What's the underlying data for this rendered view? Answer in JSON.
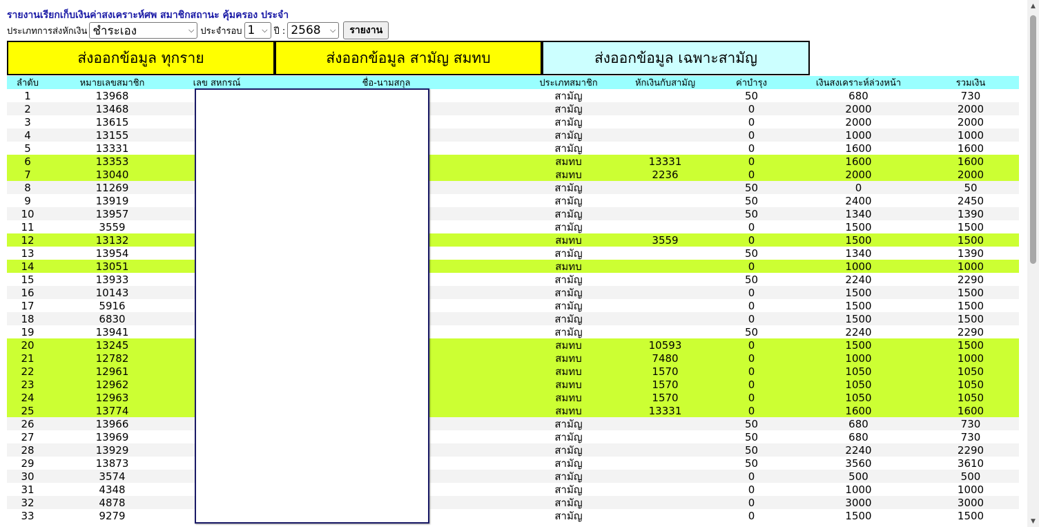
{
  "title": "รายงานเรียกเก็บเงินค่าสงเคราะห์ศพ สมาชิกสถานะ คุ้มครอง ประจำ",
  "filters": {
    "deduct_type_label": "ประเภทการส่งหักเงิน",
    "deduct_type_value": "ชำระเอง",
    "round_label": "ประจำรอบ",
    "round_value": "1",
    "year_label": "ปี :",
    "year_value": "2568",
    "report_button": "รายงาน"
  },
  "export_buttons": [
    {
      "label": "ส่งออกข้อมูล ทุกราย",
      "color": "#ffff00"
    },
    {
      "label": "ส่งออกข้อมูล สามัญ สมทบ",
      "color": "#ffff00"
    },
    {
      "label": "ส่งออกข้อมูล เฉพาะสามัญ",
      "color": "#ccffff"
    }
  ],
  "colors": {
    "header_bg": "#99ffff",
    "highlight_row": "#ccff33",
    "alt_row": "#f3f3f3",
    "title": "#1a1aa6"
  },
  "table": {
    "headers": [
      "ลำดับ",
      "หมายเลขสมาชิก",
      "เลข สหกรณ์",
      "ชื่อ-นามสกุล",
      "ประเภทสมาชิก",
      "หักเงินกับสามัญ",
      "ค่าบำรุง",
      "เงินสงเคราะห์ล่วงหน้า",
      "รวมเงิน"
    ],
    "rows": [
      [
        "1",
        "13968",
        "",
        "",
        "สามัญ",
        "",
        "50",
        "680",
        "730"
      ],
      [
        "2",
        "13468",
        "",
        "",
        "สามัญ",
        "",
        "0",
        "2000",
        "2000"
      ],
      [
        "3",
        "13615",
        "",
        "",
        "สามัญ",
        "",
        "0",
        "2000",
        "2000"
      ],
      [
        "4",
        "13155",
        "",
        "",
        "สามัญ",
        "",
        "0",
        "1000",
        "1000"
      ],
      [
        "5",
        "13331",
        "",
        "",
        "สามัญ",
        "",
        "0",
        "1600",
        "1600"
      ],
      [
        "6",
        "13353",
        "",
        "",
        "สมทบ",
        "13331",
        "0",
        "1600",
        "1600"
      ],
      [
        "7",
        "13040",
        "",
        "",
        "สมทบ",
        "2236",
        "0",
        "2000",
        "2000"
      ],
      [
        "8",
        "11269",
        "",
        "",
        "สามัญ",
        "",
        "50",
        "0",
        "50"
      ],
      [
        "9",
        "13919",
        "",
        "",
        "สามัญ",
        "",
        "50",
        "2400",
        "2450"
      ],
      [
        "10",
        "13957",
        "",
        "",
        "สามัญ",
        "",
        "50",
        "1340",
        "1390"
      ],
      [
        "11",
        "3559",
        "",
        "",
        "สามัญ",
        "",
        "0",
        "1500",
        "1500"
      ],
      [
        "12",
        "13132",
        "",
        "",
        "สมทบ",
        "3559",
        "0",
        "1500",
        "1500"
      ],
      [
        "13",
        "13954",
        "",
        "",
        "สามัญ",
        "",
        "50",
        "1340",
        "1390"
      ],
      [
        "14",
        "13051",
        "",
        "",
        "สมทบ",
        "",
        "0",
        "1000",
        "1000"
      ],
      [
        "15",
        "13933",
        "",
        "",
        "สามัญ",
        "",
        "50",
        "2240",
        "2290"
      ],
      [
        "16",
        "10143",
        "",
        "",
        "สามัญ",
        "",
        "0",
        "1500",
        "1500"
      ],
      [
        "17",
        "5916",
        "",
        "",
        "สามัญ",
        "",
        "0",
        "1500",
        "1500"
      ],
      [
        "18",
        "6830",
        "",
        "",
        "สามัญ",
        "",
        "0",
        "1500",
        "1500"
      ],
      [
        "19",
        "13941",
        "",
        "",
        "สามัญ",
        "",
        "50",
        "2240",
        "2290"
      ],
      [
        "20",
        "13245",
        "",
        "",
        "สมทบ",
        "10593",
        "0",
        "1500",
        "1500"
      ],
      [
        "21",
        "12782",
        "",
        "",
        "สมทบ",
        "7480",
        "0",
        "1000",
        "1000"
      ],
      [
        "22",
        "12961",
        "",
        "",
        "สมทบ",
        "1570",
        "0",
        "1050",
        "1050"
      ],
      [
        "23",
        "12962",
        "",
        "",
        "สมทบ",
        "1570",
        "0",
        "1050",
        "1050"
      ],
      [
        "24",
        "12963",
        "",
        "",
        "สมทบ",
        "1570",
        "0",
        "1050",
        "1050"
      ],
      [
        "25",
        "13774",
        "",
        "",
        "สมทบ",
        "13331",
        "0",
        "1600",
        "1600"
      ],
      [
        "26",
        "13966",
        "",
        "",
        "สามัญ",
        "",
        "50",
        "680",
        "730"
      ],
      [
        "27",
        "13969",
        "",
        "",
        "สามัญ",
        "",
        "50",
        "680",
        "730"
      ],
      [
        "28",
        "13929",
        "",
        "",
        "สามัญ",
        "",
        "50",
        "2240",
        "2290"
      ],
      [
        "29",
        "13873",
        "",
        "",
        "สามัญ",
        "",
        "50",
        "3560",
        "3610"
      ],
      [
        "30",
        "3574",
        "",
        "",
        "สามัญ",
        "",
        "0",
        "500",
        "500"
      ],
      [
        "31",
        "4348",
        "",
        "",
        "สามัญ",
        "",
        "0",
        "1000",
        "1000"
      ],
      [
        "32",
        "4878",
        "",
        "",
        "สามัญ",
        "",
        "0",
        "3000",
        "3000"
      ],
      [
        "33",
        "9279",
        "",
        "",
        "สามัญ",
        "",
        "0",
        "1500",
        "1500"
      ]
    ],
    "highlight_type": "สมทบ"
  },
  "icons": {
    "dropdown": "chevron-down-icon",
    "scroll_up": "arrow-up-icon",
    "scroll_down": "arrow-down-icon"
  }
}
